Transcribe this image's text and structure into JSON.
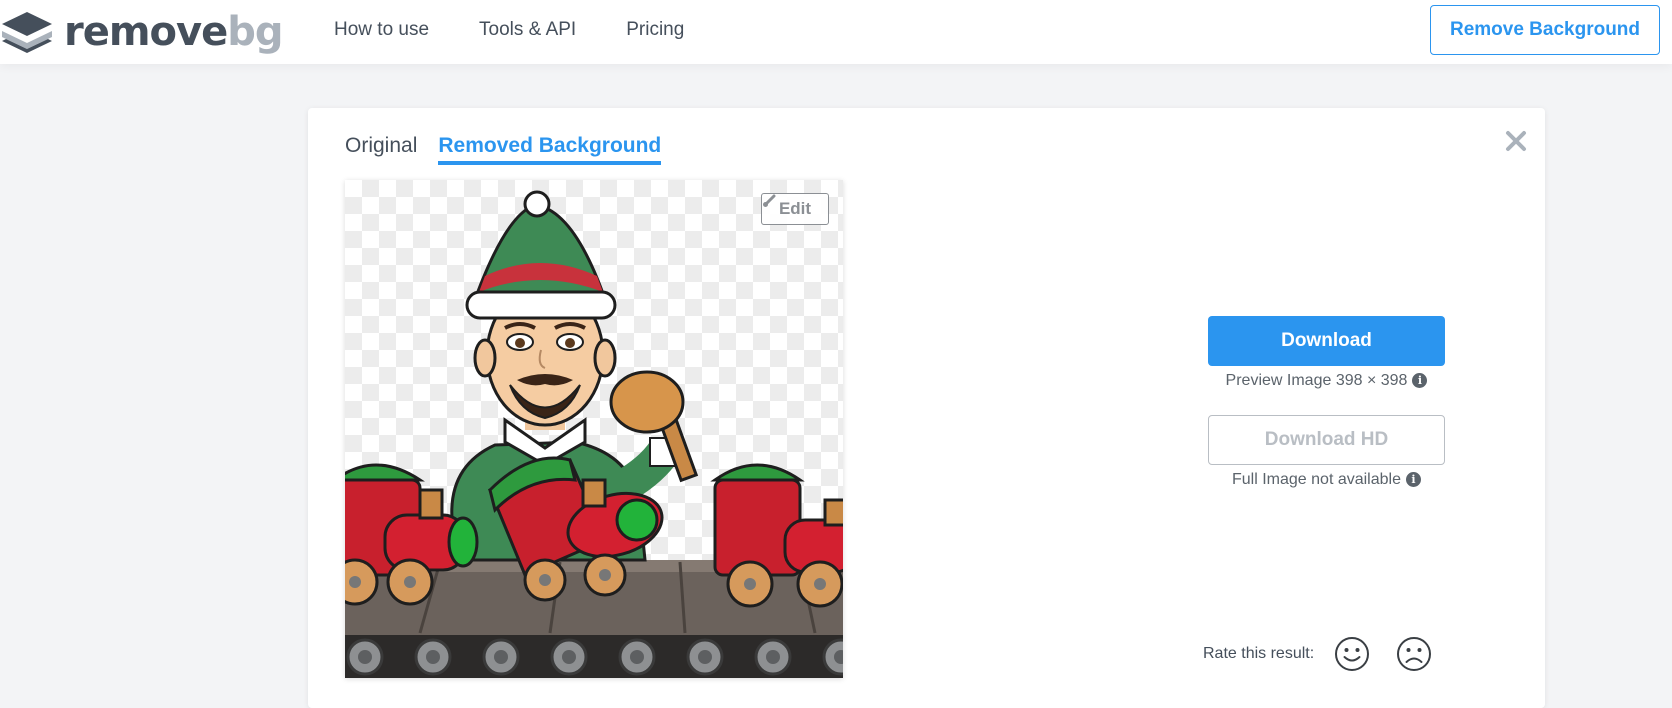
{
  "header": {
    "logo": {
      "part1": "remove",
      "part2": "bg"
    },
    "nav": [
      {
        "label": "How to use"
      },
      {
        "label": "Tools & API"
      },
      {
        "label": "Pricing"
      }
    ],
    "cta_label": "Remove Background"
  },
  "result": {
    "tabs": [
      {
        "label": "Original",
        "active": false
      },
      {
        "label": "Removed Background",
        "active": true
      }
    ],
    "edit_label": "Edit",
    "download_label": "Download",
    "preview_info": "Preview Image 398 × 398",
    "download_hd_label": "Download HD",
    "hd_info": "Full Image not available",
    "rate_label": "Rate this result:"
  },
  "icons": {
    "logo": "stacked-layers-icon",
    "close": "close-icon",
    "edit": "brush-icon",
    "info": "info-icon",
    "rate_positive": "smiley-face-icon",
    "rate_negative": "frowning-face-icon"
  },
  "colors": {
    "accent": "#2b95ef",
    "text_dark": "#454f5b",
    "logo_light": "#aab2bb",
    "disabled": "#b9bec4",
    "page_bg": "#f3f4f6"
  }
}
